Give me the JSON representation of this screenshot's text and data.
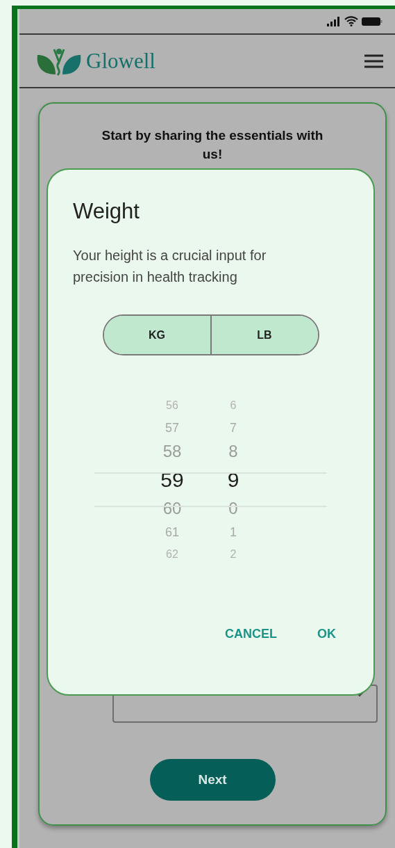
{
  "app": {
    "name": "Glowell"
  },
  "card": {
    "title": "Start by sharing the essentials with us!",
    "next_button": "Next"
  },
  "dialog": {
    "title": "Weight",
    "description": "Your height is a crucial input for precision in health tracking",
    "units": [
      {
        "label": "KG"
      },
      {
        "label": "LB"
      }
    ],
    "picker": {
      "columns": [
        {
          "items": [
            {
              "value": "56",
              "selected": false
            },
            {
              "value": "57",
              "selected": false
            },
            {
              "value": "58",
              "selected": false
            },
            {
              "value": "59",
              "selected": true
            },
            {
              "value": "60",
              "selected": false
            },
            {
              "value": "61",
              "selected": false
            },
            {
              "value": "62",
              "selected": false
            }
          ]
        },
        {
          "items": [
            {
              "value": "6",
              "selected": false
            },
            {
              "value": "7",
              "selected": false
            },
            {
              "value": "8",
              "selected": false
            },
            {
              "value": "9",
              "selected": true
            },
            {
              "value": "0",
              "selected": false
            },
            {
              "value": "1",
              "selected": false
            },
            {
              "value": "2",
              "selected": false
            }
          ]
        }
      ]
    },
    "buttons": [
      {
        "label": "CANCEL"
      },
      {
        "label": "OK"
      }
    ]
  }
}
